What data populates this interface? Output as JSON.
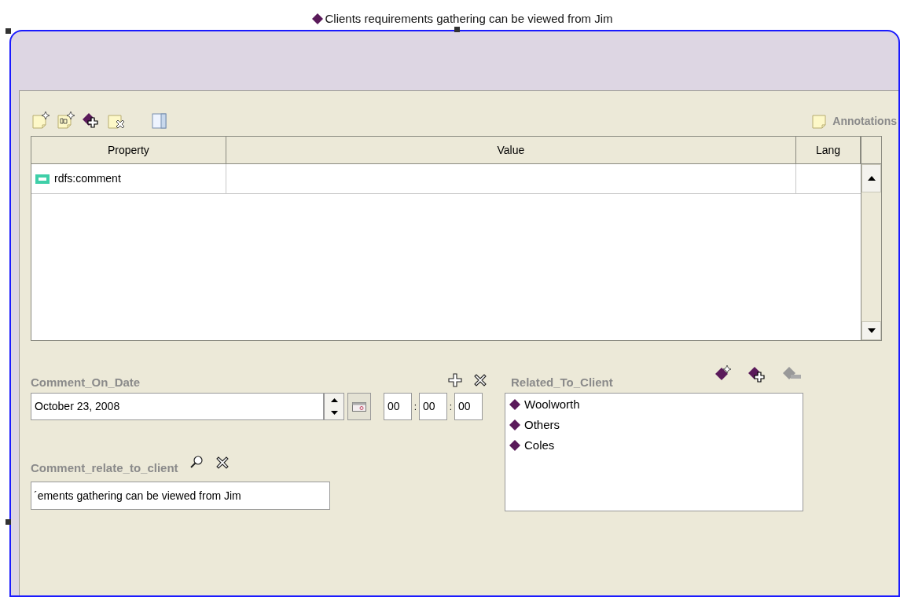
{
  "title": "Clients requirements gathering can be viewed from Jim",
  "annotations": {
    "label": "Annotations"
  },
  "table": {
    "columns": [
      "Property",
      "Value",
      "Lang"
    ],
    "rows": [
      {
        "property": "rdfs:comment"
      }
    ]
  },
  "comment_on_date": {
    "label": "Comment_On_Date",
    "value": "October 23, 2008",
    "time": [
      {
        "kind": "field",
        "text": "00"
      },
      {
        "kind": "separator",
        "text": ":"
      },
      {
        "kind": "field",
        "text": "00"
      },
      {
        "kind": "separator",
        "text": ":"
      },
      {
        "kind": "field",
        "text": "00"
      }
    ]
  },
  "comment_relate_to_client": {
    "label": "Comment_relate_to_client",
    "value": "´ements gathering can be viewed from Jim"
  },
  "related_to_client": {
    "label": "Related_To_Client",
    "items": [
      "Woolworth",
      "Others",
      "Coles"
    ]
  }
}
